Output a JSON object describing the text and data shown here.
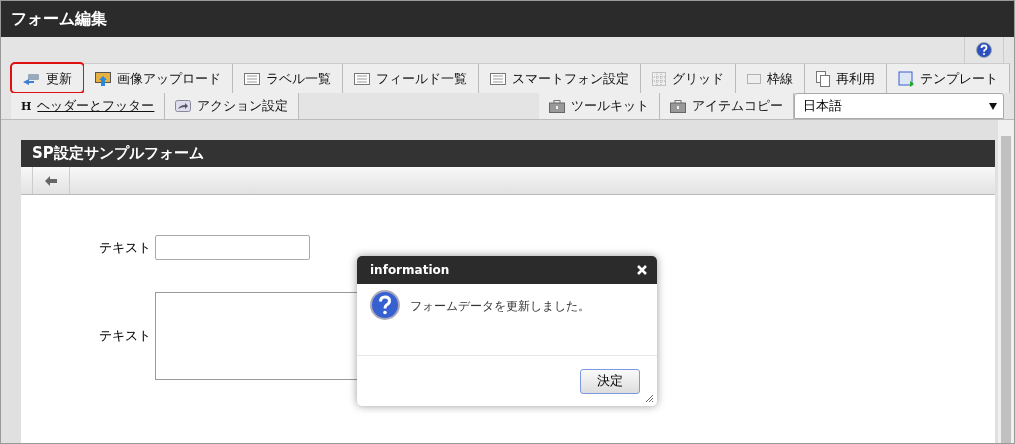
{
  "window": {
    "title": "フォーム編集"
  },
  "toolbar_tabs": [
    {
      "label": "更新",
      "highlighted": true
    },
    {
      "label": "画像アップロード",
      "highlighted": false
    },
    {
      "label": "ラベル一覧",
      "highlighted": false
    },
    {
      "label": "フィールド一覧",
      "highlighted": false
    },
    {
      "label": "スマートフォン設定",
      "highlighted": false
    },
    {
      "label": "グリッド",
      "highlighted": false
    },
    {
      "label": "枠線",
      "highlighted": false
    },
    {
      "label": "再利用",
      "highlighted": false
    },
    {
      "label": "テンプレート",
      "highlighted": false
    }
  ],
  "left_tabs": [
    {
      "label": "ヘッダーとフッター",
      "icon_text": "H",
      "link": true
    },
    {
      "label": "アクション設定",
      "link": false
    }
  ],
  "right_tabs": [
    {
      "label": "ツールキット"
    },
    {
      "label": "アイテムコピー"
    }
  ],
  "language_select": {
    "value": "日本語"
  },
  "form": {
    "title": "SP設定サンプルフォーム",
    "fields": [
      {
        "label": "テキスト",
        "kind": "input"
      },
      {
        "label": "テキスト",
        "kind": "textarea"
      }
    ]
  },
  "dialog": {
    "title": "information",
    "message": "フォームデータを更新しました。",
    "button": "決定"
  }
}
